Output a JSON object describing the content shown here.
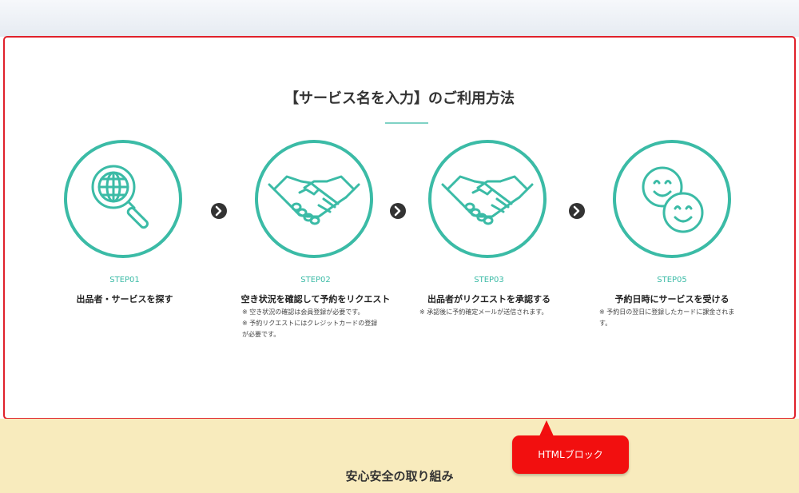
{
  "block": {
    "title": "【サービス名を入力】のご利用方法"
  },
  "steps": [
    {
      "label": "STEP01",
      "title": "出品者・サービスを探す",
      "icon": "magnifier-globe-icon",
      "notes": []
    },
    {
      "label": "STEP02",
      "title": "空き状況を確認して予約をリクエスト",
      "icon": "handshake-icon",
      "notes": [
        "※ 空き状況の確認は会員登録が必要です。",
        "※ 予約リクエストにはクレジットカードの登録",
        "が必要です。"
      ]
    },
    {
      "label": "STEP03",
      "title": "出品者がリクエストを承認する",
      "icon": "handshake-icon",
      "notes": [
        "※ 承認後に予約確定メールが送信されます。"
      ]
    },
    {
      "label": "STEP05",
      "title": "予約日時にサービスを受ける",
      "icon": "smiley-faces-icon",
      "notes": [
        "※ 予約日の翌日に登録したカードに課金されま",
        "す。"
      ]
    }
  ],
  "colors": {
    "accent": "#3bbba6",
    "tooltip": "#f20f0f",
    "block_border": "#e0212b",
    "next_section_bg": "#f8ebbd"
  },
  "tooltip": {
    "label": "HTMLブロック"
  },
  "next_section": {
    "title": "安心安全の取り組み"
  }
}
